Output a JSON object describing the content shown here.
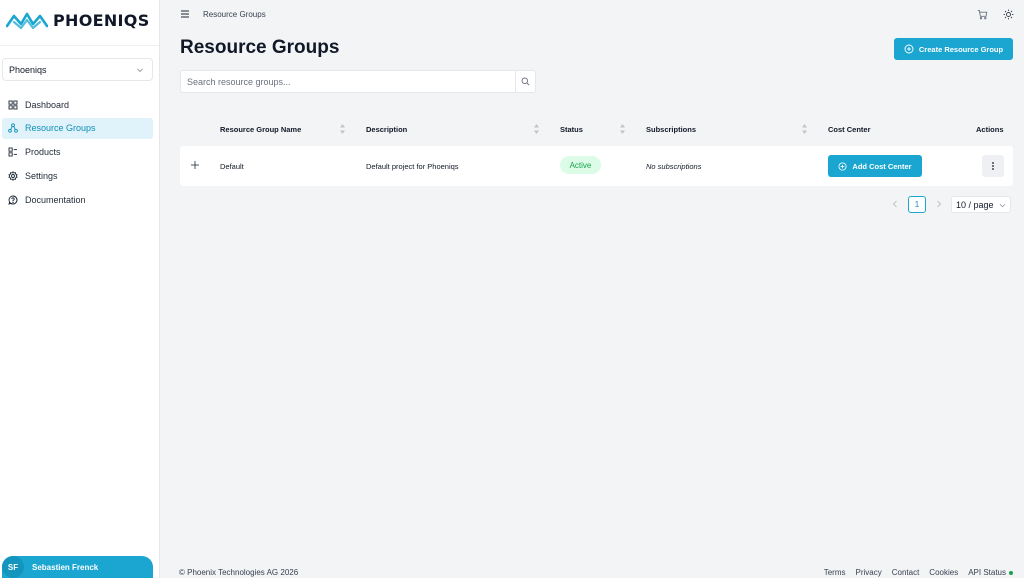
{
  "brand": {
    "name": "PHOENIQS",
    "color": "#1aa6d0"
  },
  "sidebar": {
    "org_selector": {
      "value": "Phoeniqs"
    },
    "items": [
      {
        "label": "Dashboard",
        "icon": "dashboard-icon",
        "active": false
      },
      {
        "label": "Resource Groups",
        "icon": "resource-groups-icon",
        "active": true
      },
      {
        "label": "Products",
        "icon": "products-icon",
        "active": false
      },
      {
        "label": "Settings",
        "icon": "gear-icon",
        "active": false
      },
      {
        "label": "Documentation",
        "icon": "documentation-icon",
        "active": false
      }
    ],
    "user": {
      "initials": "SF",
      "name": "Sebastien Frenck"
    }
  },
  "topbar": {
    "breadcrumb": "Resource Groups",
    "icons": [
      "menu-icon",
      "cart-icon",
      "theme-toggle-icon"
    ]
  },
  "page": {
    "title": "Resource Groups",
    "create_button": "Create Resource Group",
    "search": {
      "placeholder": "Search resource groups...",
      "value": ""
    }
  },
  "table": {
    "columns": {
      "name": "Resource Group Name",
      "description": "Description",
      "status": "Status",
      "subscriptions": "Subscriptions",
      "cost_center": "Cost Center",
      "actions": "Actions"
    },
    "rows": [
      {
        "name": "Default",
        "description": "Default project for Phoeniqs",
        "status": "Active",
        "subscriptions": "No subscriptions",
        "cost_center_button": "Add Cost Center"
      }
    ]
  },
  "pagination": {
    "current_page": "1",
    "page_size": "10 / page"
  },
  "footer": {
    "copyright": "© Phoenix Technologies AG 2026",
    "links": [
      "Terms",
      "Privacy",
      "Contact",
      "Cookies"
    ],
    "api_status": "API Status",
    "api_status_color": "#16a34a"
  }
}
